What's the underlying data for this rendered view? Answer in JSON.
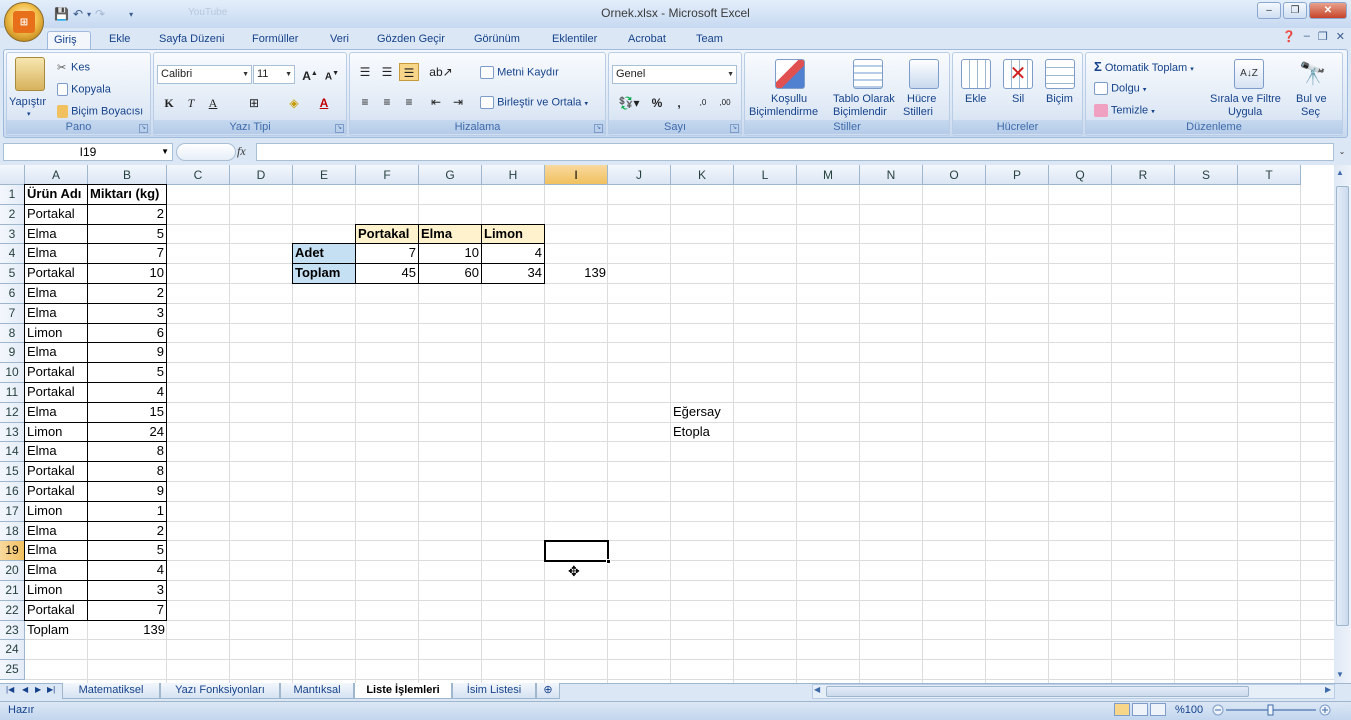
{
  "window": {
    "title": "Ornek.xlsx - Microsoft Excel",
    "qat_ghost": "YouTube"
  },
  "tabs": [
    "Giriş",
    "Ekle",
    "Sayfa Düzeni",
    "Formüller",
    "Veri",
    "Gözden Geçir",
    "Görünüm",
    "Eklentiler",
    "Acrobat",
    "Team"
  ],
  "ribbon": {
    "pano": {
      "label": "Pano",
      "paste": "Yapıştır",
      "cut": "Kes",
      "copy": "Kopyala",
      "format_painter": "Biçim Boyacısı"
    },
    "font": {
      "label": "Yazı Tipi",
      "name": "Calibri",
      "size": "11",
      "bold": "K",
      "italic": "T",
      "underline": "A"
    },
    "align": {
      "label": "Hizalama",
      "wrap": "Metni Kaydır",
      "merge": "Birleştir ve Ortala"
    },
    "number": {
      "label": "Sayı",
      "format": "Genel",
      "percent": "%",
      "comma": ","
    },
    "styles": {
      "label": "Stiller",
      "cond": "Koşullu",
      "cond2": "Biçimlendirme",
      "table": "Tablo Olarak",
      "table2": "Biçimlendir",
      "cell": "Hücre",
      "cell2": "Stilleri"
    },
    "cells": {
      "label": "Hücreler",
      "insert": "Ekle",
      "delete": "Sil",
      "format": "Biçim"
    },
    "edit": {
      "label": "Düzenleme",
      "autosum": "Otomatik Toplam",
      "fill": "Dolgu",
      "clear": "Temizle",
      "sort": "Sırala ve Filtre",
      "sort2": "Uygula",
      "find": "Bul ve",
      "find2": "Seç"
    }
  },
  "formula_bar": {
    "name_box": "I19",
    "fx": "fx",
    "value": ""
  },
  "columns": [
    "A",
    "B",
    "C",
    "D",
    "E",
    "F",
    "G",
    "H",
    "I",
    "J",
    "K",
    "L",
    "M",
    "N",
    "O",
    "P",
    "Q",
    "R",
    "S",
    "T"
  ],
  "rows": [
    "1",
    "2",
    "3",
    "4",
    "5",
    "6",
    "7",
    "8",
    "9",
    "10",
    "11",
    "12",
    "13",
    "14",
    "15",
    "16",
    "17",
    "18",
    "19",
    "20",
    "21",
    "22",
    "23",
    "24",
    "25"
  ],
  "selected": {
    "column": "I",
    "row": "19"
  },
  "list": {
    "header_product": "Ürün Adı",
    "header_qty": "Miktarı (kg)",
    "items": [
      {
        "name": "Portakal",
        "qty": "2"
      },
      {
        "name": "Elma",
        "qty": "5"
      },
      {
        "name": "Elma",
        "qty": "7"
      },
      {
        "name": "Portakal",
        "qty": "10"
      },
      {
        "name": "Elma",
        "qty": "2"
      },
      {
        "name": "Elma",
        "qty": "3"
      },
      {
        "name": "Limon",
        "qty": "6"
      },
      {
        "name": "Elma",
        "qty": "9"
      },
      {
        "name": "Portakal",
        "qty": "5"
      },
      {
        "name": "Portakal",
        "qty": "4"
      },
      {
        "name": "Elma",
        "qty": "15"
      },
      {
        "name": "Limon",
        "qty": "24"
      },
      {
        "name": "Elma",
        "qty": "8"
      },
      {
        "name": "Portakal",
        "qty": "8"
      },
      {
        "name": "Portakal",
        "qty": "9"
      },
      {
        "name": "Limon",
        "qty": "1"
      },
      {
        "name": "Elma",
        "qty": "2"
      },
      {
        "name": "Elma",
        "qty": "5"
      },
      {
        "name": "Elma",
        "qty": "4"
      },
      {
        "name": "Limon",
        "qty": "3"
      },
      {
        "name": "Portakal",
        "qty": "7"
      }
    ],
    "total_label": "Toplam",
    "total_value": "139"
  },
  "summary": {
    "headers": [
      "Portakal",
      "Elma",
      "Limon"
    ],
    "count_label": "Adet",
    "counts": [
      "7",
      "10",
      "4"
    ],
    "sum_label": "Toplam",
    "sums": [
      "45",
      "60",
      "34"
    ],
    "grand_total": "139"
  },
  "notes": [
    "Eğersay",
    "Etopla"
  ],
  "sheet_tabs": [
    "Matematiksel",
    "Yazı Fonksiyonları",
    "Mantıksal",
    "Liste İşlemleri",
    "İsim Listesi"
  ],
  "active_sheet": "Liste İşlemleri",
  "status": {
    "text": "Hazır",
    "zoom": "%100"
  },
  "colors": {
    "header_fill": "#fff2cc",
    "label_fill": "#c5e0f3",
    "selected_header": "#f1c15f"
  }
}
